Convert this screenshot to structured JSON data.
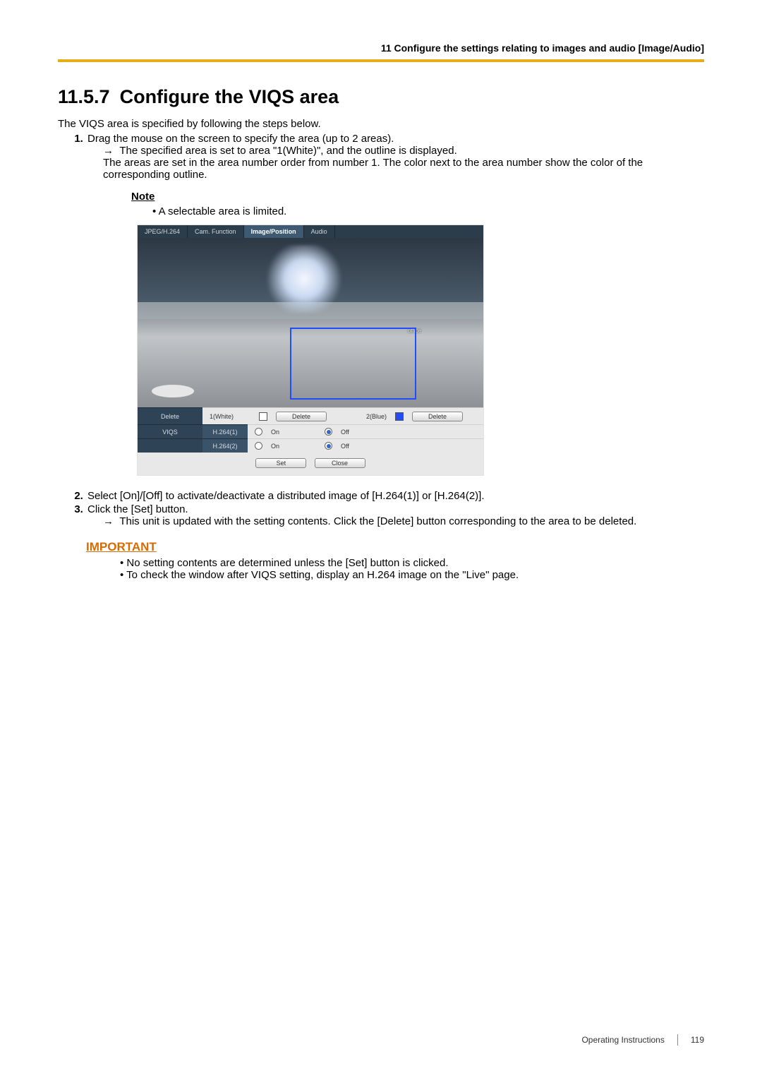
{
  "header": {
    "running": "11 Configure the settings relating to images and audio [Image/Audio]"
  },
  "title": {
    "num": "11.5.7",
    "text": "Configure the VIQS area"
  },
  "intro": "The VIQS area is specified by following the steps below.",
  "steps": {
    "s1": "Drag the mouse on the screen to specify the area (up to 2 areas).",
    "s1_arrow": "The specified area is set to area \"1(White)\", and the outline is displayed.",
    "s1_cont": "The areas are set in the area number order from number 1. The color next to the area number show the color of the corresponding outline.",
    "s2": "Select [On]/[Off] to activate/deactivate a distributed image of [H.264(1)] or [H.264(2)].",
    "s3": "Click the [Set] button.",
    "s3_arrow": "This unit is updated with the setting contents. Click the [Delete] button corresponding to the area to be deleted."
  },
  "note": {
    "hd": "Note",
    "b1": "A selectable area is limited."
  },
  "important": {
    "hd": "IMPORTANT",
    "b1": "No setting contents are determined unless the [Set] button is clicked.",
    "b2": "To check the window after VIQS setting, display an H.264 image on the \"Live\" page."
  },
  "shot": {
    "tabs": {
      "t1": "JPEG/H.264",
      "t2": "Cam. Function",
      "t3": "Image/Position",
      "t4": "Audio"
    },
    "office": "office",
    "row_delete": "Delete",
    "area1": "1(White)",
    "area2": "2(Blue)",
    "btn_delete": "Delete",
    "viqs": "VIQS",
    "h1": "H.264(1)",
    "h2": "H.264(2)",
    "on": "On",
    "off": "Off",
    "set": "Set",
    "close": "Close"
  },
  "footer": {
    "doc": "Operating Instructions",
    "page": "119"
  }
}
